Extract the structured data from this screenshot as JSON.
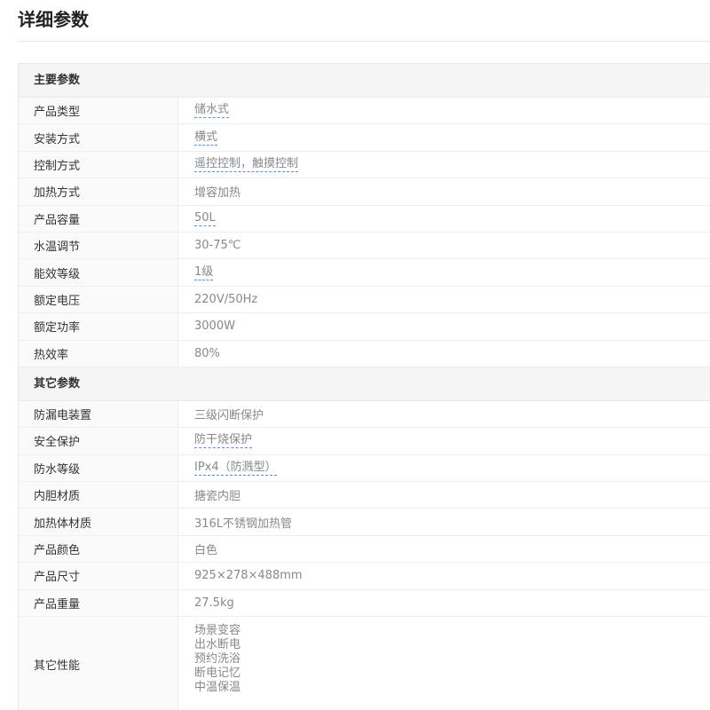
{
  "page": {
    "title": "详细参数"
  },
  "sections": {
    "main": {
      "title": "主要参数",
      "rows": [
        {
          "label": "产品类型",
          "value": "储水式",
          "linked": true
        },
        {
          "label": "安装方式",
          "value": "横式",
          "linked": true
        },
        {
          "label": "控制方式",
          "value": "遥控控制，触摸控制",
          "linked": true
        },
        {
          "label": "加热方式",
          "value": "增容加热",
          "linked": false
        },
        {
          "label": "产品容量",
          "value": "50L",
          "linked": true
        },
        {
          "label": "水温调节",
          "value": "30-75℃",
          "linked": false
        },
        {
          "label": "能效等级",
          "value": "1级",
          "linked": true
        },
        {
          "label": "额定电压",
          "value": "220V/50Hz",
          "linked": false
        },
        {
          "label": "额定功率",
          "value": "3000W",
          "linked": false
        },
        {
          "label": "热效率",
          "value": "80%",
          "linked": false
        }
      ]
    },
    "other": {
      "title": "其它参数",
      "rows": [
        {
          "label": "防漏电装置",
          "value": "三级闪断保护",
          "linked": false
        },
        {
          "label": "安全保护",
          "value": "防干烧保护",
          "linked": true
        },
        {
          "label": "防水等级",
          "value": "IPx4（防溅型）",
          "linked": true
        },
        {
          "label": "内胆材质",
          "value": "搪瓷内胆",
          "linked": false
        },
        {
          "label": "加热体材质",
          "value": "316L不锈钢加热管",
          "linked": false
        },
        {
          "label": "产品颜色",
          "value": "白色",
          "linked": false
        },
        {
          "label": "产品尺寸",
          "value": "925×278×488mm",
          "linked": false
        },
        {
          "label": "产品重量",
          "value": "27.5kg",
          "linked": false
        }
      ],
      "features": {
        "label": "其它性能",
        "values": [
          "场景变容",
          "出水断电",
          "预约洗浴",
          "断电记忆",
          "中温保温"
        ]
      }
    }
  },
  "colors": {
    "link_underline": "#5b8fd8",
    "value_text": "#888888",
    "label_text": "#333333",
    "section_bg": "#f5f5f5"
  }
}
